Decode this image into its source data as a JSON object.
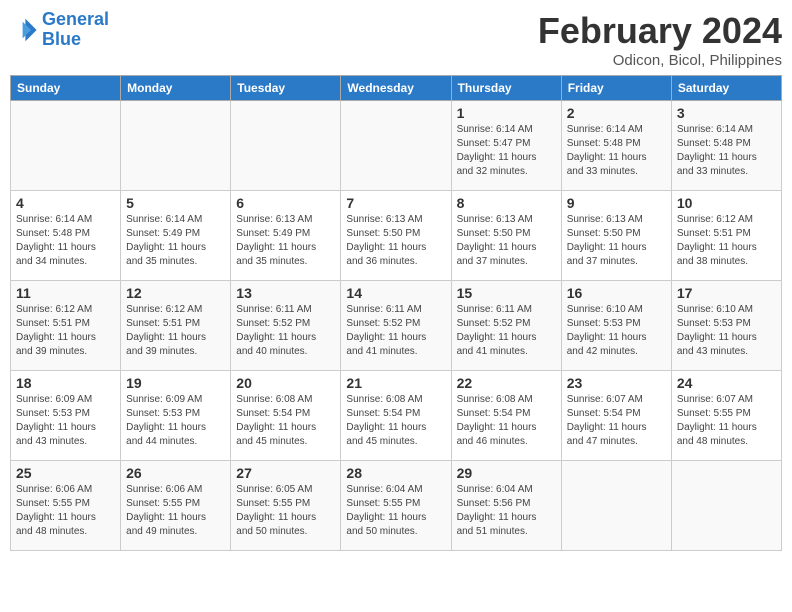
{
  "header": {
    "logo_line1": "General",
    "logo_line2": "Blue",
    "month_year": "February 2024",
    "location": "Odicon, Bicol, Philippines"
  },
  "weekdays": [
    "Sunday",
    "Monday",
    "Tuesday",
    "Wednesday",
    "Thursday",
    "Friday",
    "Saturday"
  ],
  "weeks": [
    [
      {
        "day": "",
        "info": ""
      },
      {
        "day": "",
        "info": ""
      },
      {
        "day": "",
        "info": ""
      },
      {
        "day": "",
        "info": ""
      },
      {
        "day": "1",
        "info": "Sunrise: 6:14 AM\nSunset: 5:47 PM\nDaylight: 11 hours\nand 32 minutes."
      },
      {
        "day": "2",
        "info": "Sunrise: 6:14 AM\nSunset: 5:48 PM\nDaylight: 11 hours\nand 33 minutes."
      },
      {
        "day": "3",
        "info": "Sunrise: 6:14 AM\nSunset: 5:48 PM\nDaylight: 11 hours\nand 33 minutes."
      }
    ],
    [
      {
        "day": "4",
        "info": "Sunrise: 6:14 AM\nSunset: 5:48 PM\nDaylight: 11 hours\nand 34 minutes."
      },
      {
        "day": "5",
        "info": "Sunrise: 6:14 AM\nSunset: 5:49 PM\nDaylight: 11 hours\nand 35 minutes."
      },
      {
        "day": "6",
        "info": "Sunrise: 6:13 AM\nSunset: 5:49 PM\nDaylight: 11 hours\nand 35 minutes."
      },
      {
        "day": "7",
        "info": "Sunrise: 6:13 AM\nSunset: 5:50 PM\nDaylight: 11 hours\nand 36 minutes."
      },
      {
        "day": "8",
        "info": "Sunrise: 6:13 AM\nSunset: 5:50 PM\nDaylight: 11 hours\nand 37 minutes."
      },
      {
        "day": "9",
        "info": "Sunrise: 6:13 AM\nSunset: 5:50 PM\nDaylight: 11 hours\nand 37 minutes."
      },
      {
        "day": "10",
        "info": "Sunrise: 6:12 AM\nSunset: 5:51 PM\nDaylight: 11 hours\nand 38 minutes."
      }
    ],
    [
      {
        "day": "11",
        "info": "Sunrise: 6:12 AM\nSunset: 5:51 PM\nDaylight: 11 hours\nand 39 minutes."
      },
      {
        "day": "12",
        "info": "Sunrise: 6:12 AM\nSunset: 5:51 PM\nDaylight: 11 hours\nand 39 minutes."
      },
      {
        "day": "13",
        "info": "Sunrise: 6:11 AM\nSunset: 5:52 PM\nDaylight: 11 hours\nand 40 minutes."
      },
      {
        "day": "14",
        "info": "Sunrise: 6:11 AM\nSunset: 5:52 PM\nDaylight: 11 hours\nand 41 minutes."
      },
      {
        "day": "15",
        "info": "Sunrise: 6:11 AM\nSunset: 5:52 PM\nDaylight: 11 hours\nand 41 minutes."
      },
      {
        "day": "16",
        "info": "Sunrise: 6:10 AM\nSunset: 5:53 PM\nDaylight: 11 hours\nand 42 minutes."
      },
      {
        "day": "17",
        "info": "Sunrise: 6:10 AM\nSunset: 5:53 PM\nDaylight: 11 hours\nand 43 minutes."
      }
    ],
    [
      {
        "day": "18",
        "info": "Sunrise: 6:09 AM\nSunset: 5:53 PM\nDaylight: 11 hours\nand 43 minutes."
      },
      {
        "day": "19",
        "info": "Sunrise: 6:09 AM\nSunset: 5:53 PM\nDaylight: 11 hours\nand 44 minutes."
      },
      {
        "day": "20",
        "info": "Sunrise: 6:08 AM\nSunset: 5:54 PM\nDaylight: 11 hours\nand 45 minutes."
      },
      {
        "day": "21",
        "info": "Sunrise: 6:08 AM\nSunset: 5:54 PM\nDaylight: 11 hours\nand 45 minutes."
      },
      {
        "day": "22",
        "info": "Sunrise: 6:08 AM\nSunset: 5:54 PM\nDaylight: 11 hours\nand 46 minutes."
      },
      {
        "day": "23",
        "info": "Sunrise: 6:07 AM\nSunset: 5:54 PM\nDaylight: 11 hours\nand 47 minutes."
      },
      {
        "day": "24",
        "info": "Sunrise: 6:07 AM\nSunset: 5:55 PM\nDaylight: 11 hours\nand 48 minutes."
      }
    ],
    [
      {
        "day": "25",
        "info": "Sunrise: 6:06 AM\nSunset: 5:55 PM\nDaylight: 11 hours\nand 48 minutes."
      },
      {
        "day": "26",
        "info": "Sunrise: 6:06 AM\nSunset: 5:55 PM\nDaylight: 11 hours\nand 49 minutes."
      },
      {
        "day": "27",
        "info": "Sunrise: 6:05 AM\nSunset: 5:55 PM\nDaylight: 11 hours\nand 50 minutes."
      },
      {
        "day": "28",
        "info": "Sunrise: 6:04 AM\nSunset: 5:55 PM\nDaylight: 11 hours\nand 50 minutes."
      },
      {
        "day": "29",
        "info": "Sunrise: 6:04 AM\nSunset: 5:56 PM\nDaylight: 11 hours\nand 51 minutes."
      },
      {
        "day": "",
        "info": ""
      },
      {
        "day": "",
        "info": ""
      }
    ]
  ]
}
